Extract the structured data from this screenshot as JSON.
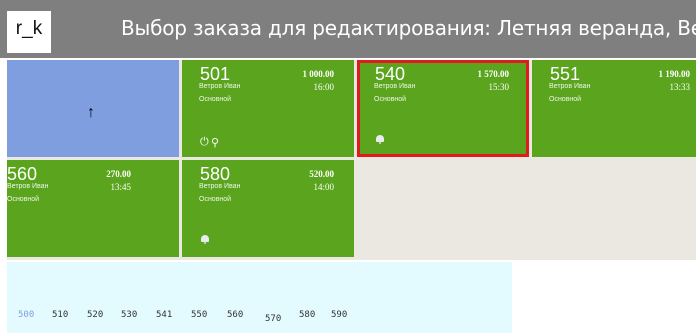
{
  "app": {
    "logo": "r_k"
  },
  "header": {
    "title": "Выбор заказа для редактирования: Летняя веранда, Ветров"
  },
  "nav": {
    "up_arrow": "↑"
  },
  "orders": [
    {
      "number": "501",
      "amount": "1 000.00",
      "time": "16:00",
      "waiter": "Ветров Иван",
      "type": "Основной",
      "icons": [
        "clock-icon",
        "pin-icon"
      ],
      "selected": false
    },
    {
      "number": "540",
      "amount": "1 570.00",
      "time": "15:30",
      "waiter": "Ветров Иван",
      "type": "Основной",
      "icons": [
        "bell-icon"
      ],
      "selected": true
    },
    {
      "number": "551",
      "amount": "1 190.00",
      "time": "13:33",
      "waiter": "Ветров Иван",
      "type": "Основной",
      "icons": [],
      "selected": false
    },
    {
      "number": "560",
      "amount": "270.00",
      "time": "13:45",
      "waiter": "Ветров Иван",
      "type": "Основной",
      "icons": [],
      "selected": false
    },
    {
      "number": "580",
      "amount": "520.00",
      "time": "14:00",
      "waiter": "Ветров Иван",
      "type": "Основной",
      "icons": [
        "bell-icon"
      ],
      "selected": false
    }
  ],
  "icon_glyphs": {
    "clock": "⏻",
    "pin": "⚲"
  },
  "tables": {
    "active": "500",
    "items": [
      "500",
      "510",
      "520",
      "530",
      "541",
      "550",
      "560",
      "570",
      "580",
      "590"
    ]
  },
  "colors": {
    "tile": "#5aa51d",
    "up_tile": "#7f9ee0",
    "selected_border": "#e01b1b",
    "tables_bg": "#e3fbfe",
    "header": "#7f7f7f"
  }
}
